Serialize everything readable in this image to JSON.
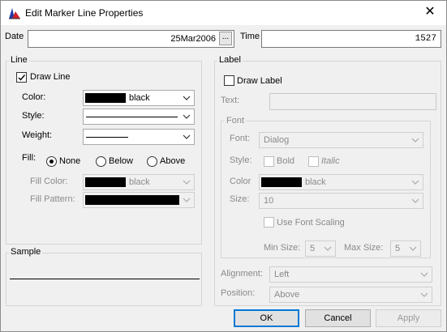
{
  "window": {
    "title": "Edit Marker Line Properties"
  },
  "date": {
    "label": "Date",
    "value": "25Mar2006",
    "picker_label": "..."
  },
  "time": {
    "label": "Time",
    "value": "1527"
  },
  "line": {
    "group_title": "Line",
    "draw_line_label": "Draw Line",
    "draw_line_checked": true,
    "color_label": "Color:",
    "color_value": "black",
    "style_label": "Style:",
    "weight_label": "Weight:",
    "fill_label": "Fill:",
    "fill_options": [
      "None",
      "Below",
      "Above"
    ],
    "fill_selected": "None",
    "fill_color_label": "Fill Color:",
    "fill_color_value": "black",
    "fill_pattern_label": "Fill Pattern:"
  },
  "sample": {
    "group_title": "Sample"
  },
  "label": {
    "group_title": "Label",
    "draw_label_label": "Draw Label",
    "draw_label_checked": false,
    "text_label": "Text:",
    "text_value": "",
    "font_group_title": "Font",
    "font_label": "Font:",
    "font_value": "Dialog",
    "style_label": "Style:",
    "bold_label": "Bold",
    "italic_label": "Italic",
    "color_label": "Color",
    "color_value": "black",
    "size_label": "Size:",
    "size_value": "10",
    "use_font_scaling_label": "Use Font Scaling",
    "min_size_label": "Min Size:",
    "min_size_value": "5",
    "max_size_label": "Max Size:",
    "max_size_value": "5",
    "alignment_label": "Alignment:",
    "alignment_value": "Left",
    "position_label": "Position:",
    "position_value": "Above"
  },
  "buttons": {
    "ok": "OK",
    "cancel": "Cancel",
    "apply": "Apply"
  },
  "colors": {
    "accent": "#0078d7",
    "swatch": "#000000"
  }
}
